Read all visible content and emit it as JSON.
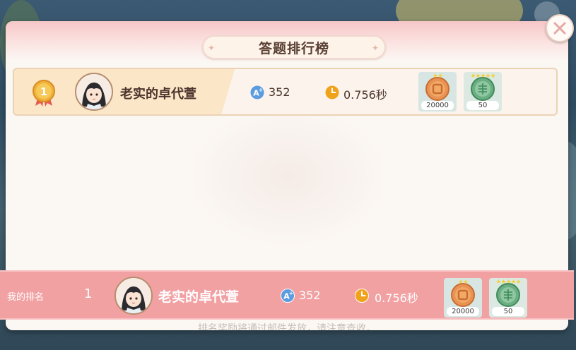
{
  "window": {
    "title": "答题排行榜",
    "footer_hint": "排名奖励将通过邮件发放，请注意查收。"
  },
  "leaderboard": {
    "rows": [
      {
        "rank": 1,
        "name": "老实的卓代萱",
        "score": "352",
        "time": "0.756秒",
        "rewards": [
          {
            "icon": "bronze-coin-icon",
            "qty": "20000"
          },
          {
            "icon": "jade-token-icon",
            "qty": "50"
          }
        ]
      }
    ]
  },
  "my_rank": {
    "label": "我的排名",
    "rank": "1",
    "name": "老实的卓代萱",
    "score": "352",
    "time": "0.756秒",
    "rewards": [
      {
        "icon": "bronze-coin-icon",
        "qty": "20000"
      },
      {
        "icon": "jade-token-icon",
        "qty": "50"
      }
    ]
  },
  "colors": {
    "title_bar": "#f6c7c7",
    "my_bar": "#f2a1a3",
    "first_place": "#fbe6c8",
    "score_icon": "#5b9be0",
    "time_icon": "#f0a21a"
  }
}
